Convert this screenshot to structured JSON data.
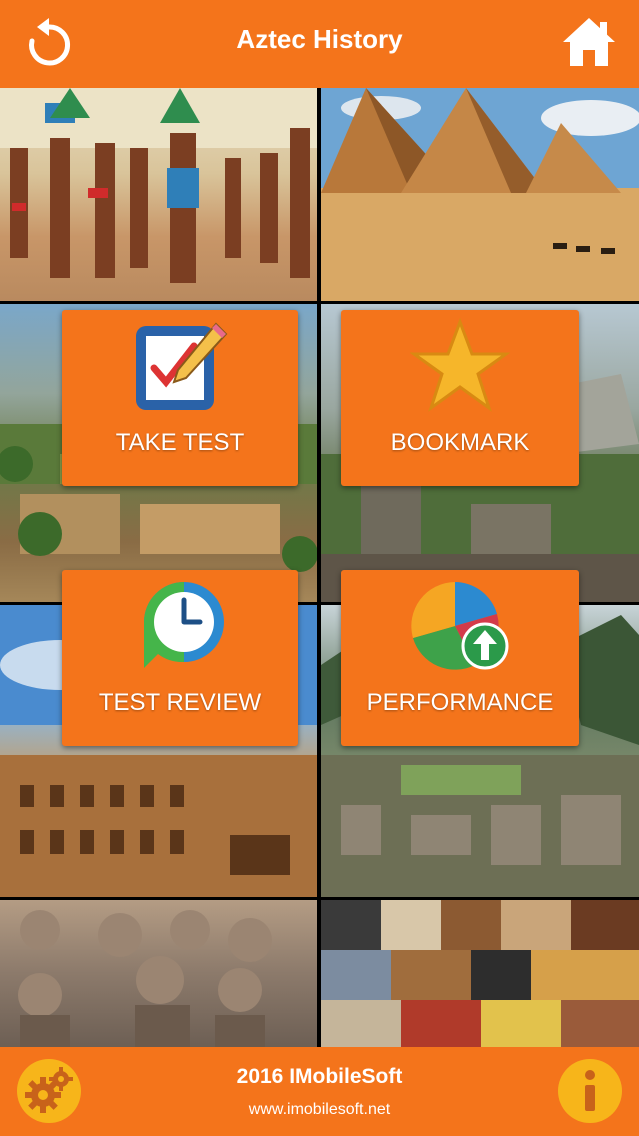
{
  "header": {
    "title": "Aztec History",
    "back_icon": "refresh-back-icon",
    "home_icon": "home-icon"
  },
  "menu": {
    "take_test": "TAKE TEST",
    "bookmark": "BOOKMARK",
    "test_review": "TEST REVIEW",
    "performance": "PERFORMANCE"
  },
  "footer": {
    "copyright": "2016 IMobileSoft",
    "url": "www.imobilesoft.net",
    "settings_icon": "gear-icon",
    "info_icon": "info-icon"
  },
  "colors": {
    "accent": "#f4741b",
    "icon_circle": "#f7b51a"
  }
}
